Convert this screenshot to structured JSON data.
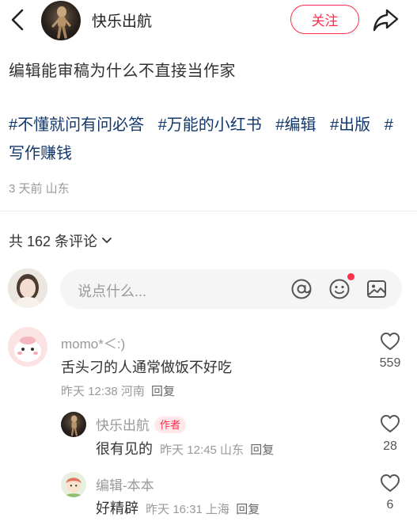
{
  "header": {
    "author_name": "快乐出航",
    "follow_label": "关注"
  },
  "note": {
    "title": "编辑能审稿为什么不直接当作家",
    "tags": [
      "#不懂就问有问必答",
      "#万能的小红书",
      "#编辑",
      "#出版",
      "#写作赚钱"
    ],
    "meta": "3 天前  山东"
  },
  "comments_section": {
    "count_label": "共 162 条评论",
    "input_placeholder": "说点什么..."
  },
  "comments": [
    {
      "name": "momo*＜:)",
      "text": "舌头刁的人通常做饭不好吃",
      "meta": "昨天 12:38 河南",
      "reply_label": "回复",
      "likes": "559"
    }
  ],
  "replies": [
    {
      "name": "快乐出航",
      "badge": "作者",
      "text": "很有见的",
      "meta": "昨天 12:45 山东",
      "reply_label": "回复",
      "likes": "28"
    },
    {
      "name": "编辑-本本",
      "text": "好精辟",
      "meta": "昨天 16:31 上海",
      "reply_label": "回复",
      "likes": "6"
    }
  ],
  "icons": {
    "back": "chevron-left-icon",
    "share": "share-arrow-icon",
    "mention": "at-icon",
    "emoji": "emoji-icon",
    "image": "image-icon",
    "like": "heart-icon",
    "dropdown": "chevron-down-icon"
  },
  "colors": {
    "accent": "#ff2e4d",
    "tag": "#13386c",
    "muted": "#999999"
  }
}
